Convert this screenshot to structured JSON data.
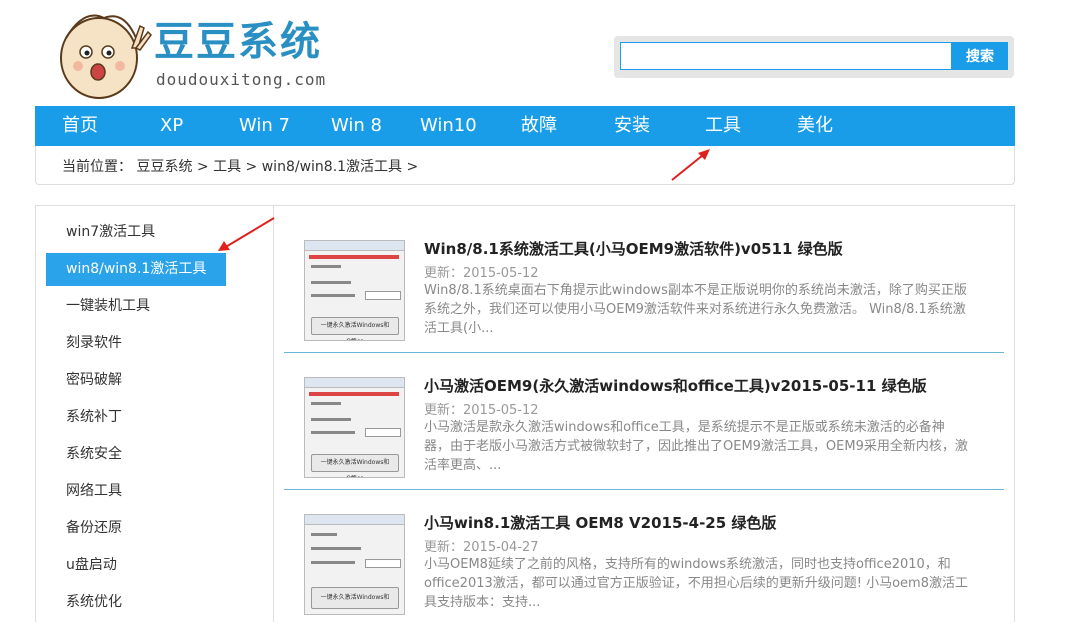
{
  "site": {
    "title": "豆豆系统",
    "url": "doudouxitong.com"
  },
  "search": {
    "placeholder": "",
    "button_label": "搜索"
  },
  "nav": {
    "items": [
      "首页",
      "XP",
      "Win 7",
      "Win 8",
      "Win10",
      "故障",
      "安装",
      "工具",
      "美化"
    ]
  },
  "breadcrumb": {
    "prefix": "当前位置：",
    "items": [
      "豆豆系统",
      "工具",
      "win8/win8.1激活工具"
    ],
    "separator": ">"
  },
  "sidebar": {
    "items": [
      "win7激活工具",
      "win8/win8.1激活工具",
      "一键装机工具",
      "刻录软件",
      "密码破解",
      "系统补丁",
      "系统安全",
      "网络工具",
      "备份还原",
      "u盘启动",
      "系统优化"
    ],
    "active_index": 1
  },
  "articles": [
    {
      "title": "Win8/8.1系统激活工具(小马OEM9激活软件)v0511 绿色版",
      "date": "更新：2015-05-12",
      "desc": "Win8/8.1系统桌面右下角提示此windows副本不是正版说明你的系统尚未激活，除了购买正版系统之外，我们还可以使用小马OEM9激活软件来对系统进行永久免费激活。 Win8/8.1系统激活工具(小...",
      "thumb_button": "一键永久激活Windows和Office"
    },
    {
      "title": "小马激活OEM9(永久激活windows和office工具)v2015-05-11 绿色版",
      "date": "更新：2015-05-12",
      "desc": "小马激活是款永久激活windows和office工具，是系统提示不是正版或系统未激活的必备神器，由于老版小马激活方式被微软封了，因此推出了OEM9激活工具，OEM9采用全新内核，激活率更高、...",
      "thumb_button": "一键永久激活Windows和Office"
    },
    {
      "title": "小马win8.1激活工具 OEM8 V2015-4-25 绿色版",
      "date": "更新：2015-04-27",
      "desc": "小马OEM8延续了之前的风格，支持所有的windows系统激活，同时也支持office2010，和office2013激活，都可以通过官方正版验证，不用担心后续的更新升级问题! 小马oem8激活工具支持版本：支持...",
      "thumb_button": "一键永久激活Windows和Office"
    }
  ],
  "colors": {
    "accent": "#1a9de8",
    "sidebar_active": "#2aa3ea",
    "annotation_arrow": "#e0201b"
  }
}
